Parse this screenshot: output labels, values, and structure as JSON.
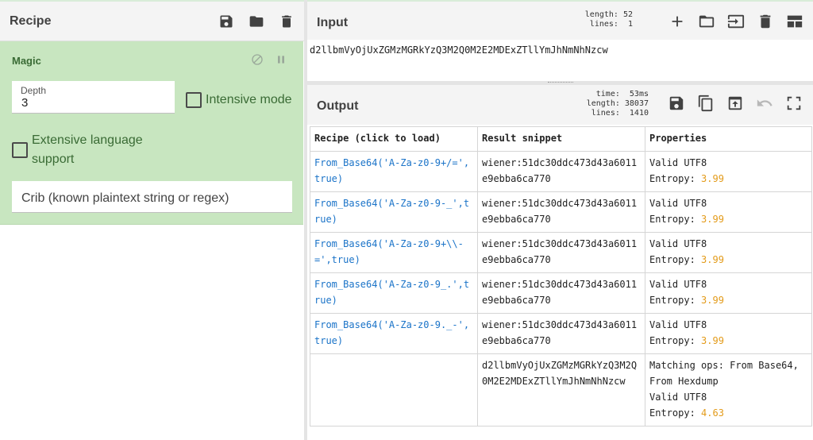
{
  "recipe": {
    "title": "Recipe",
    "icons": [
      "save-icon",
      "folder-icon",
      "trash-icon"
    ],
    "magic": {
      "title": "Magic",
      "depth_label": "Depth",
      "depth_value": "3",
      "intensive_label": "Intensive mode",
      "extensive_label": "Extensive language support",
      "crib_placeholder": "Crib (known plaintext string or regex)"
    }
  },
  "input": {
    "title": "Input",
    "stats": "length: 52\n lines:  1",
    "text": "d2llbmVyOjUxZGMzMGRkYzQ3M2Q0M2E2MDExZTllYmJhNmNhNzcw"
  },
  "output": {
    "title": "Output",
    "stats": "  time:  53ms\nlength: 38037\n lines:  1410",
    "table": {
      "headers": [
        "Recipe (click to load)",
        "Result snippet",
        "Properties"
      ],
      "rows": [
        {
          "recipe": "From_Base64('A-Za-z0-9+/=',true)",
          "snippet": "wiener:51dc30ddc473d43a6011e9ebba6ca770",
          "props": "Valid UTF8\nEntropy: ",
          "entropy": "3.99"
        },
        {
          "recipe": "From_Base64('A-Za-z0-9-_',true)",
          "snippet": "wiener:51dc30ddc473d43a6011e9ebba6ca770",
          "props": "Valid UTF8\nEntropy: ",
          "entropy": "3.99"
        },
        {
          "recipe": "From_Base64('A-Za-z0-9+\\\\-=',true)",
          "snippet": "wiener:51dc30ddc473d43a6011e9ebba6ca770",
          "props": "Valid UTF8\nEntropy: ",
          "entropy": "3.99"
        },
        {
          "recipe": "From_Base64('A-Za-z0-9_.',true)",
          "snippet": "wiener:51dc30ddc473d43a6011e9ebba6ca770",
          "props": "Valid UTF8\nEntropy: ",
          "entropy": "3.99"
        },
        {
          "recipe": "From_Base64('A-Za-z0-9._-',true)",
          "snippet": "wiener:51dc30ddc473d43a6011e9ebba6ca770",
          "props": "Valid UTF8\nEntropy: ",
          "entropy": "3.99"
        },
        {
          "recipe": "",
          "snippet": "d2llbmVyOjUxZGMzMGRkYzQ3M2Q0M2E2MDExZTllYmJhNmNhNzcw",
          "props": "Matching ops: From Base64, From Hexdump\nValid UTF8\nEntropy: ",
          "entropy": "4.63"
        }
      ]
    }
  },
  "colors": {
    "magic_bg": "#c8e6c0",
    "magic_text": "#3a6b35",
    "recipe_link": "#1a73c8",
    "entropy": "#e39b1a"
  }
}
